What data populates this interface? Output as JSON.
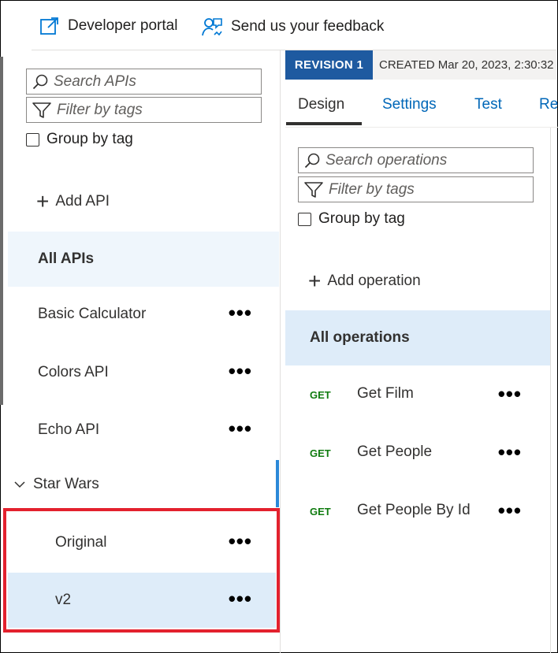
{
  "topbar": {
    "developer_portal": "Developer portal",
    "feedback": "Send us your feedback"
  },
  "apis_panel": {
    "search_placeholder": "Search APIs",
    "filter_placeholder": "Filter by tags",
    "group_by_tag": "Group by tag",
    "add_api": "Add API",
    "all_apis": "All APIs",
    "items": [
      {
        "label": "Basic Calculator"
      },
      {
        "label": "Colors API"
      },
      {
        "label": "Echo API"
      }
    ],
    "group": {
      "label": "Star Wars",
      "revisions": [
        {
          "label": "Original"
        },
        {
          "label": "v2"
        }
      ]
    }
  },
  "revision": {
    "tag": "REVISION 1",
    "created": "CREATED Mar 20, 2023, 2:30:32"
  },
  "tabs": [
    {
      "label": "Design"
    },
    {
      "label": "Settings"
    },
    {
      "label": "Test"
    },
    {
      "label": "Re"
    }
  ],
  "operations_panel": {
    "search_placeholder": "Search operations",
    "filter_placeholder": "Filter by tags",
    "group_by_tag": "Group by tag",
    "add_operation": "Add operation",
    "all_operations": "All operations",
    "operations": [
      {
        "method": "GET",
        "name": "Get Film"
      },
      {
        "method": "GET",
        "name": "Get People"
      },
      {
        "method": "GET",
        "name": "Get People By Id"
      }
    ]
  },
  "more_glyph": "•••",
  "colors": {
    "accent": "#0067b8",
    "revision_bg": "#1e5aa0",
    "selected_bg": "#deecf9",
    "highlight_box": "#e3212e",
    "get_method": "#107c10"
  }
}
